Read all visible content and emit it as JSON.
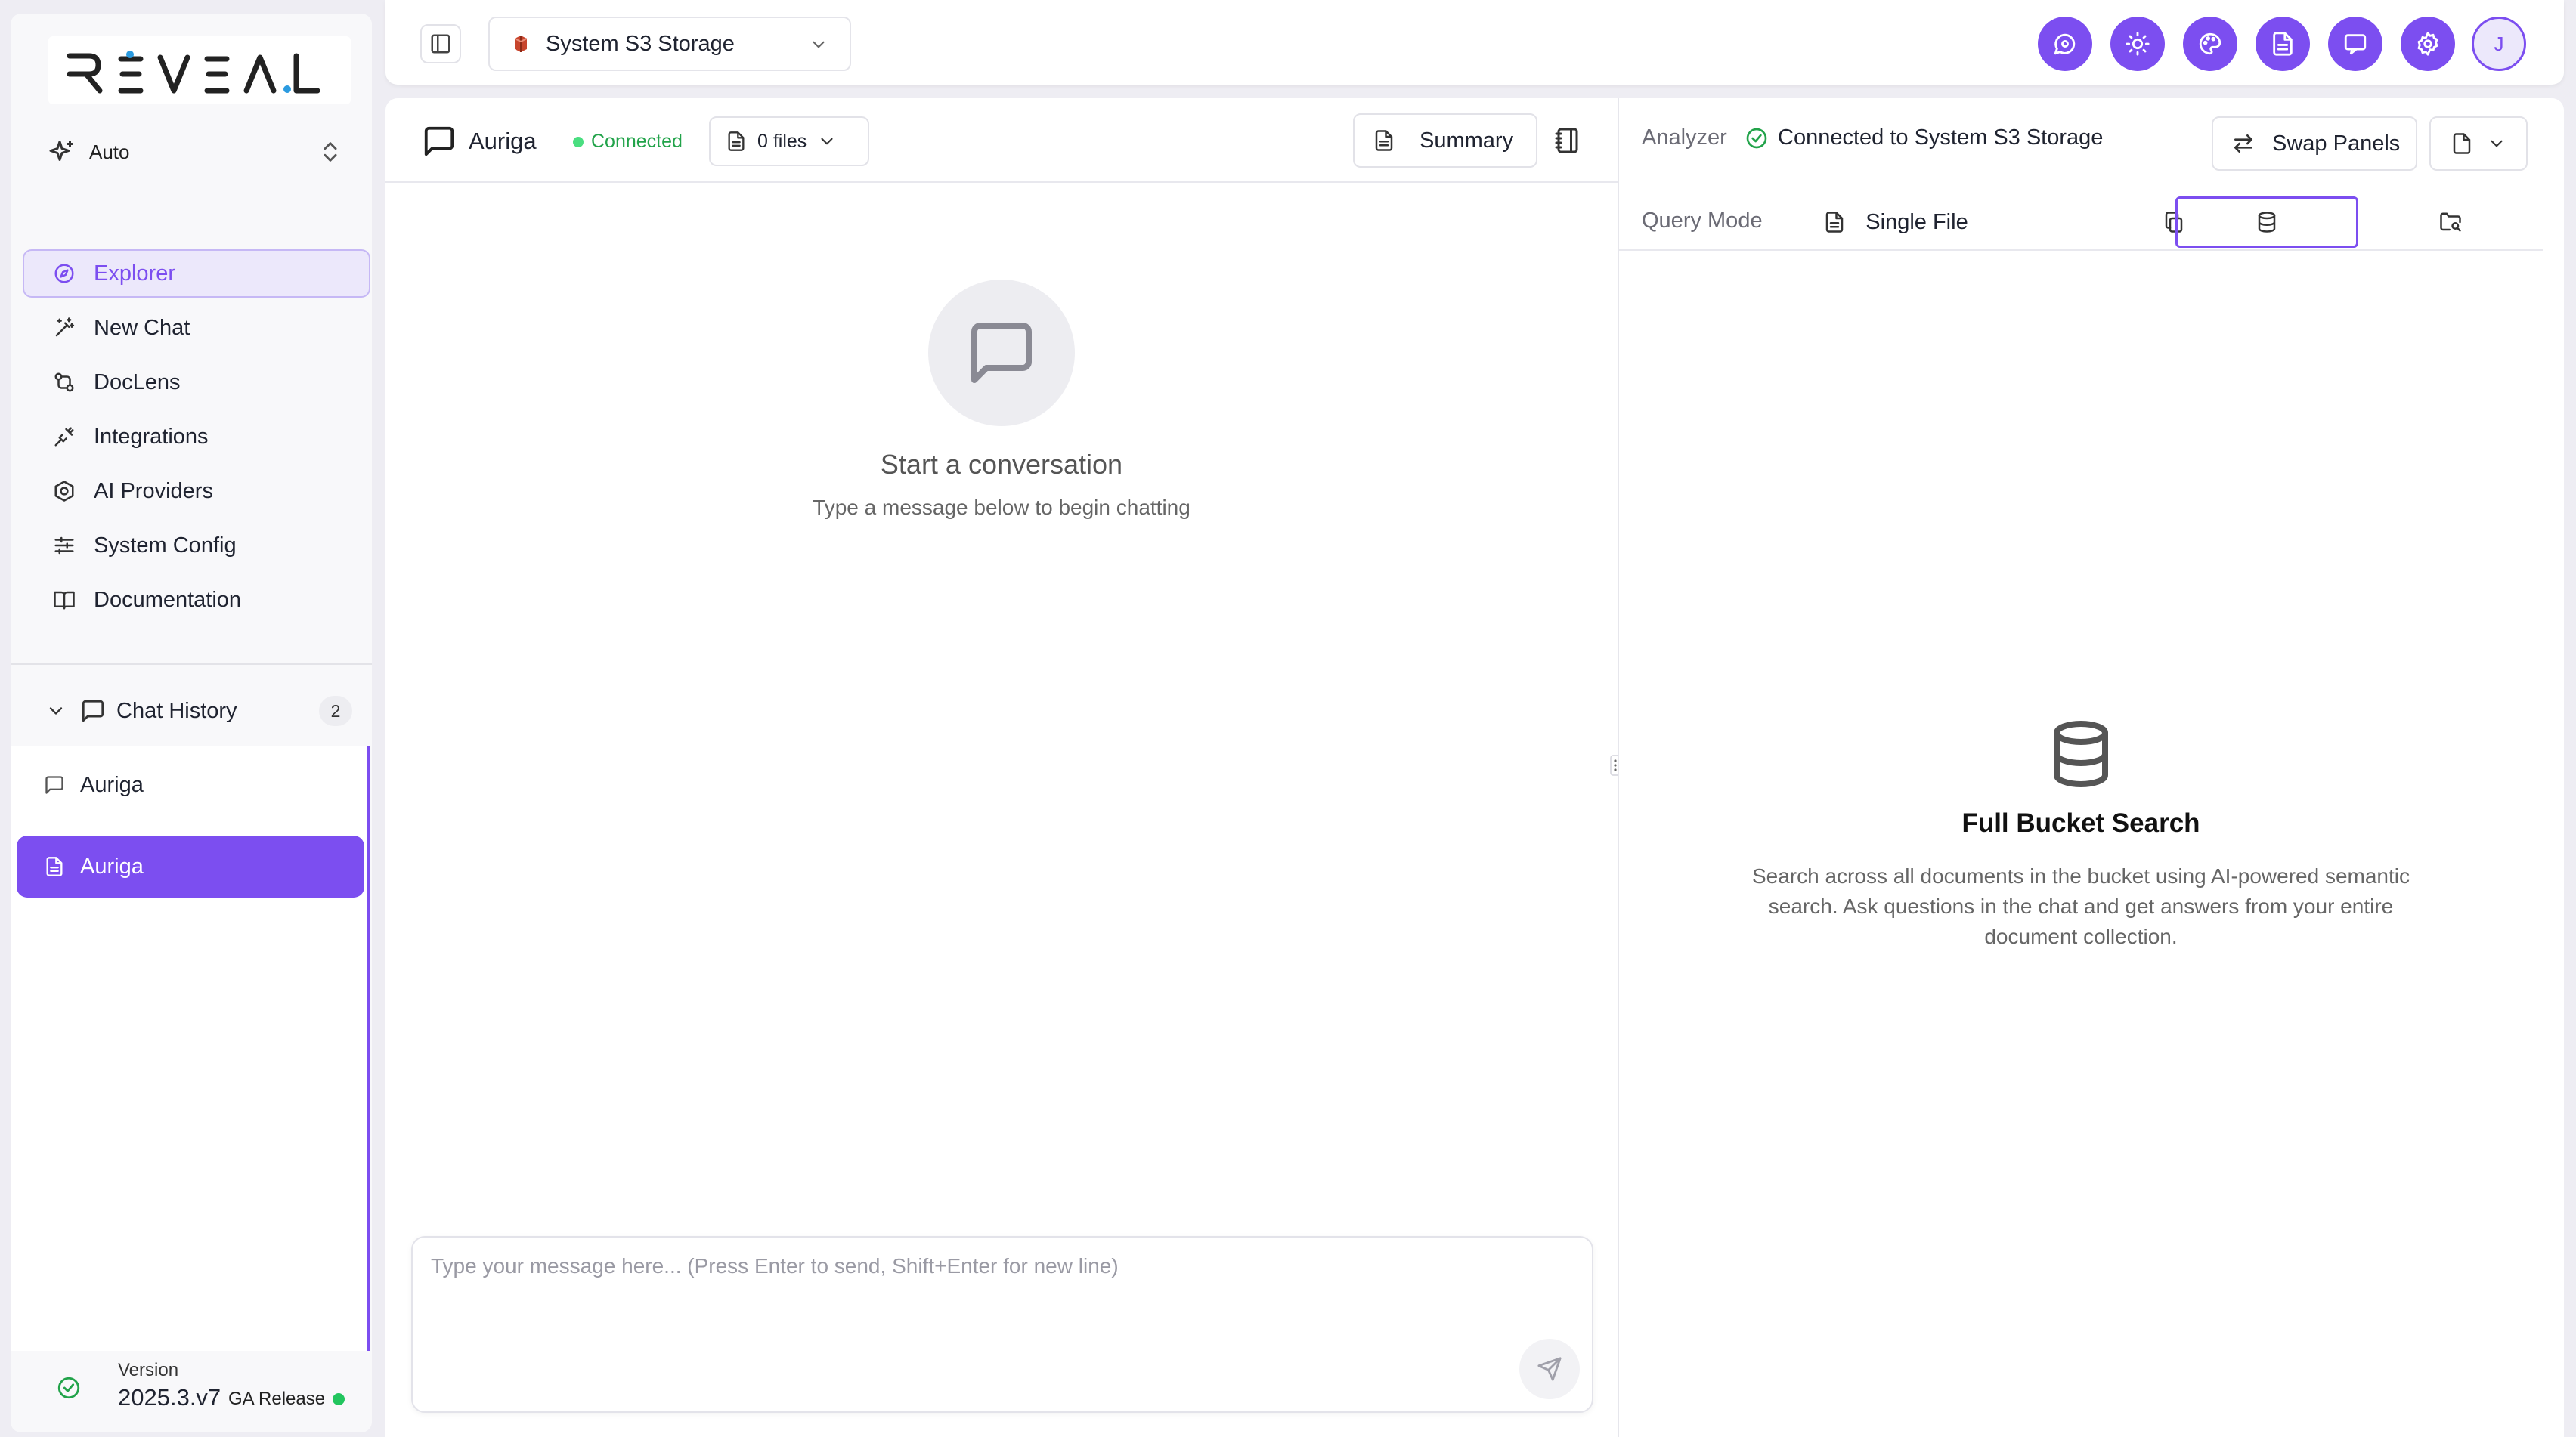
{
  "brand": {
    "logo_text": "REVEAL",
    "accent_color": "#7c4ef0",
    "logo_dot_color": "#2b9be0"
  },
  "sidebar": {
    "mode": {
      "label": "Auto",
      "icon": "sparkles-icon"
    },
    "nav": [
      {
        "label": "Explorer",
        "icon": "compass-icon",
        "active": true
      },
      {
        "label": "New Chat",
        "icon": "wand-icon"
      },
      {
        "label": "DocLens",
        "icon": "git-compare-icon"
      },
      {
        "label": "Integrations",
        "icon": "plug-icon"
      },
      {
        "label": "AI Providers",
        "icon": "hexagon-icon"
      },
      {
        "label": "System Config",
        "icon": "sliders-icon"
      },
      {
        "label": "Documentation",
        "icon": "book-icon"
      }
    ],
    "history": {
      "title": "Chat History",
      "count": "2",
      "items": [
        {
          "label": "Auriga",
          "icon": "message-square-icon"
        },
        {
          "label": "Auriga",
          "icon": "file-text-icon",
          "selected": true
        }
      ]
    },
    "version": {
      "label": "Version",
      "value": "2025.3.v7",
      "release": "GA Release",
      "status_color": "#22c55e"
    }
  },
  "topbar": {
    "storage": {
      "label": "System S3 Storage",
      "icon": "aws-s3-icon"
    },
    "buttons": [
      "chat-bubble-icon",
      "sun-icon",
      "palette-icon",
      "file-text-icon",
      "monitor-message-icon",
      "gear-icon"
    ],
    "avatar": "J"
  },
  "chat": {
    "title": "Auriga",
    "status": "Connected",
    "files_label": "0 files",
    "summary_label": "Summary",
    "empty_title": "Start a conversation",
    "empty_subtitle": "Type a message below to begin chatting",
    "input_placeholder": "Type your message here... (Press Enter to send, Shift+Enter for new line)"
  },
  "analyzer": {
    "label": "Analyzer",
    "status": "Connected to System S3 Storage",
    "swap_label": "Swap Panels",
    "query_mode_label": "Query Mode",
    "modes": [
      {
        "label": "Single File",
        "icon": "file-text-icon"
      },
      {
        "label": "",
        "icon": "copy-files-icon"
      },
      {
        "label": "",
        "icon": "database-icon",
        "active": true
      },
      {
        "label": "",
        "icon": "folder-search-icon"
      }
    ],
    "empty_title": "Full Bucket Search",
    "empty_description": "Search across all documents in the bucket using AI-powered semantic search. Ask questions in the chat and get answers from your entire document collection."
  }
}
